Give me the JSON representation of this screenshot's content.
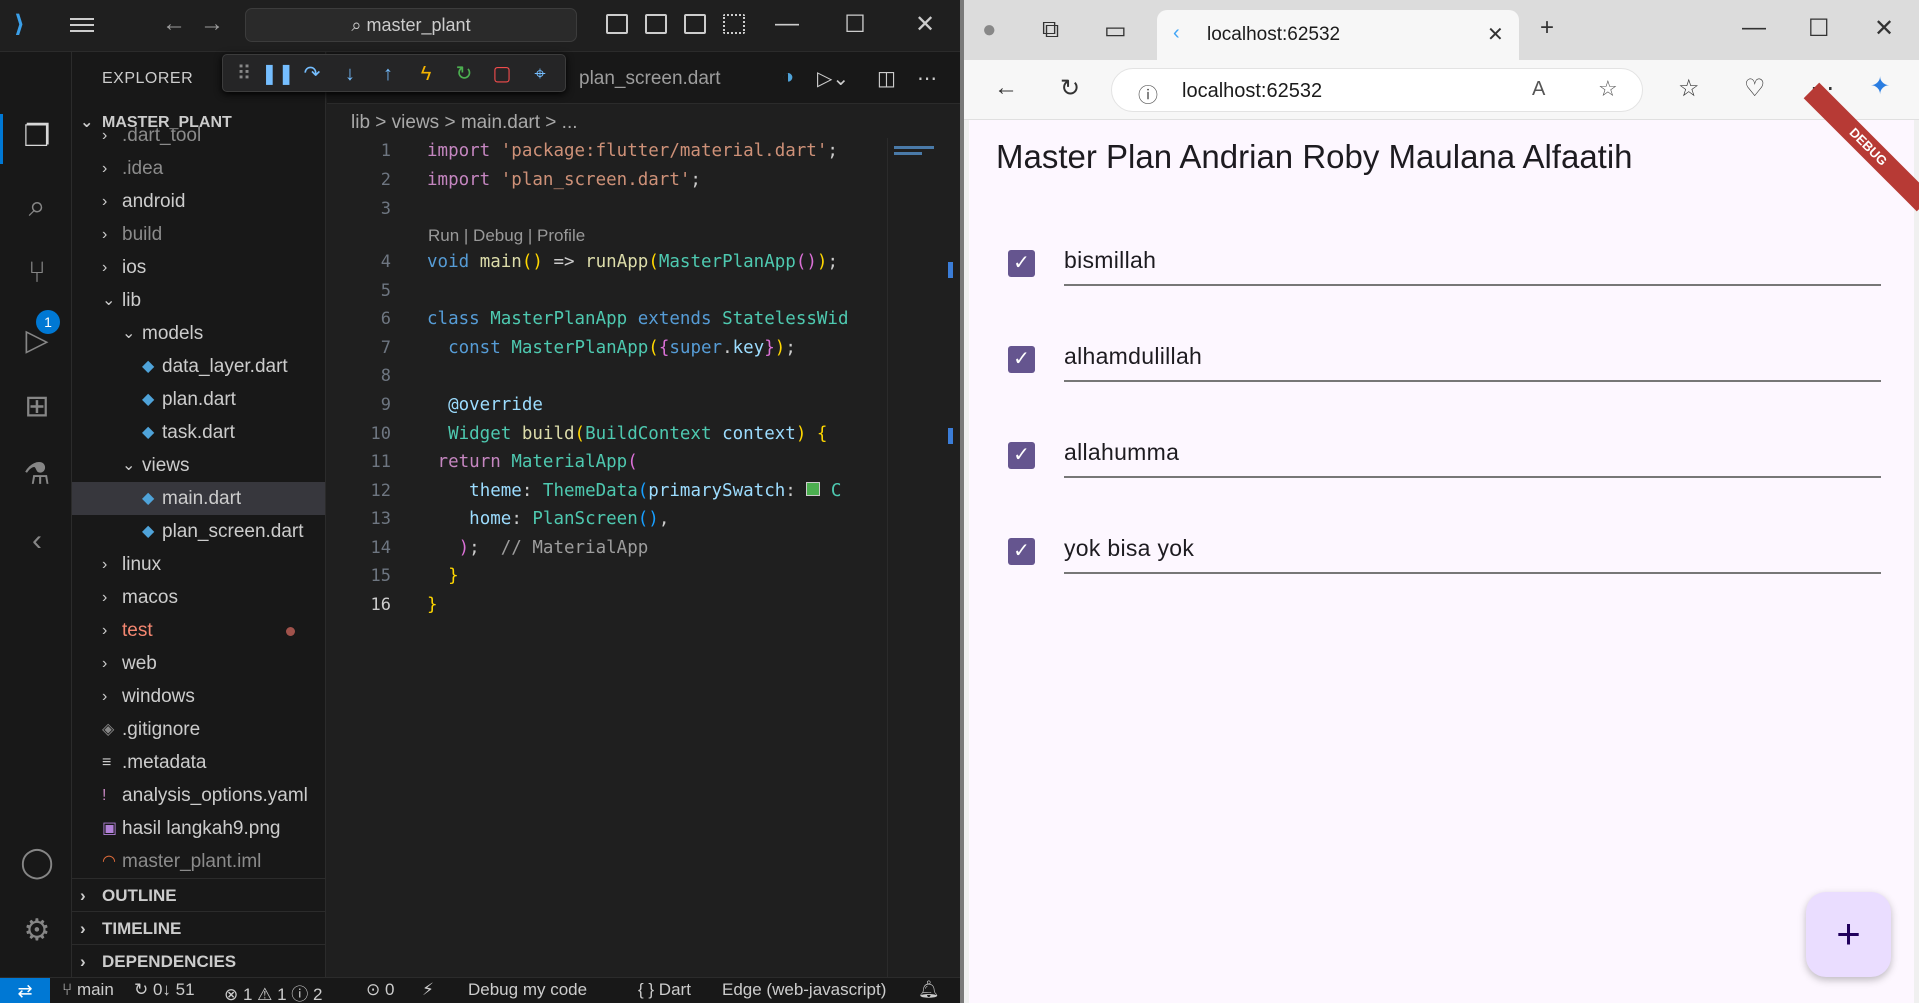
{
  "vscode": {
    "search": "master_plant",
    "explorer_title": "EXPLORER",
    "project": "MASTER_PLANT",
    "tab_label": "plan_screen.dart",
    "breadcrumb": "lib > views > main.dart > ...",
    "tree": [
      {
        "label": ".dart_tool",
        "type": "folder"
      },
      {
        "label": ".idea",
        "type": "folder"
      },
      {
        "label": "android",
        "type": "folder"
      },
      {
        "label": "build",
        "type": "folder"
      },
      {
        "label": "ios",
        "type": "folder"
      },
      {
        "label": "lib",
        "type": "folder-open"
      },
      {
        "label": "models",
        "type": "folder-open"
      },
      {
        "label": "data_layer.dart",
        "type": "dart"
      },
      {
        "label": "plan.dart",
        "type": "dart"
      },
      {
        "label": "task.dart",
        "type": "dart"
      },
      {
        "label": "views",
        "type": "folder-open"
      },
      {
        "label": "main.dart",
        "type": "dart"
      },
      {
        "label": "plan_screen.dart",
        "type": "dart"
      },
      {
        "label": "linux",
        "type": "folder"
      },
      {
        "label": "macos",
        "type": "folder"
      },
      {
        "label": "test",
        "type": "folder"
      },
      {
        "label": "web",
        "type": "folder"
      },
      {
        "label": "windows",
        "type": "folder"
      },
      {
        "label": ".gitignore",
        "type": "file"
      },
      {
        "label": ".metadata",
        "type": "file"
      },
      {
        "label": "analysis_options.yaml",
        "type": "file"
      },
      {
        "label": "hasil langkah9.png",
        "type": "image"
      },
      {
        "label": "master_plant.iml",
        "type": "file"
      }
    ],
    "sections": [
      "OUTLINE",
      "TIMELINE",
      "DEPENDENCIES"
    ],
    "codelens": "Run | Debug | Profile",
    "line_numbers": [
      "1",
      "2",
      "3",
      "4",
      "5",
      "6",
      "7",
      "8",
      "9",
      "10",
      "11",
      "12",
      "13",
      "14",
      "15",
      "16"
    ],
    "status": {
      "branch": "main",
      "sync": "0↓ 51",
      "problems": "⊗ 1 ⚠ 1 ⓘ 2",
      "ports": "0",
      "debug": "Debug my code",
      "language": "{ } Dart",
      "device": "Edge (web-javascript)"
    }
  },
  "browser": {
    "tab_title": "localhost:62532",
    "url": "localhost:62532",
    "app_title": "Master Plan Andrian Roby Maulana Alfaatih",
    "debug_banner": "DEBUG",
    "tasks": [
      {
        "label": "bismillah",
        "checked": true
      },
      {
        "label": "alhamdulillah",
        "checked": true
      },
      {
        "label": "allahumma",
        "checked": true
      },
      {
        "label": "yok bisa yok",
        "checked": true
      }
    ],
    "fab_label": "+"
  }
}
